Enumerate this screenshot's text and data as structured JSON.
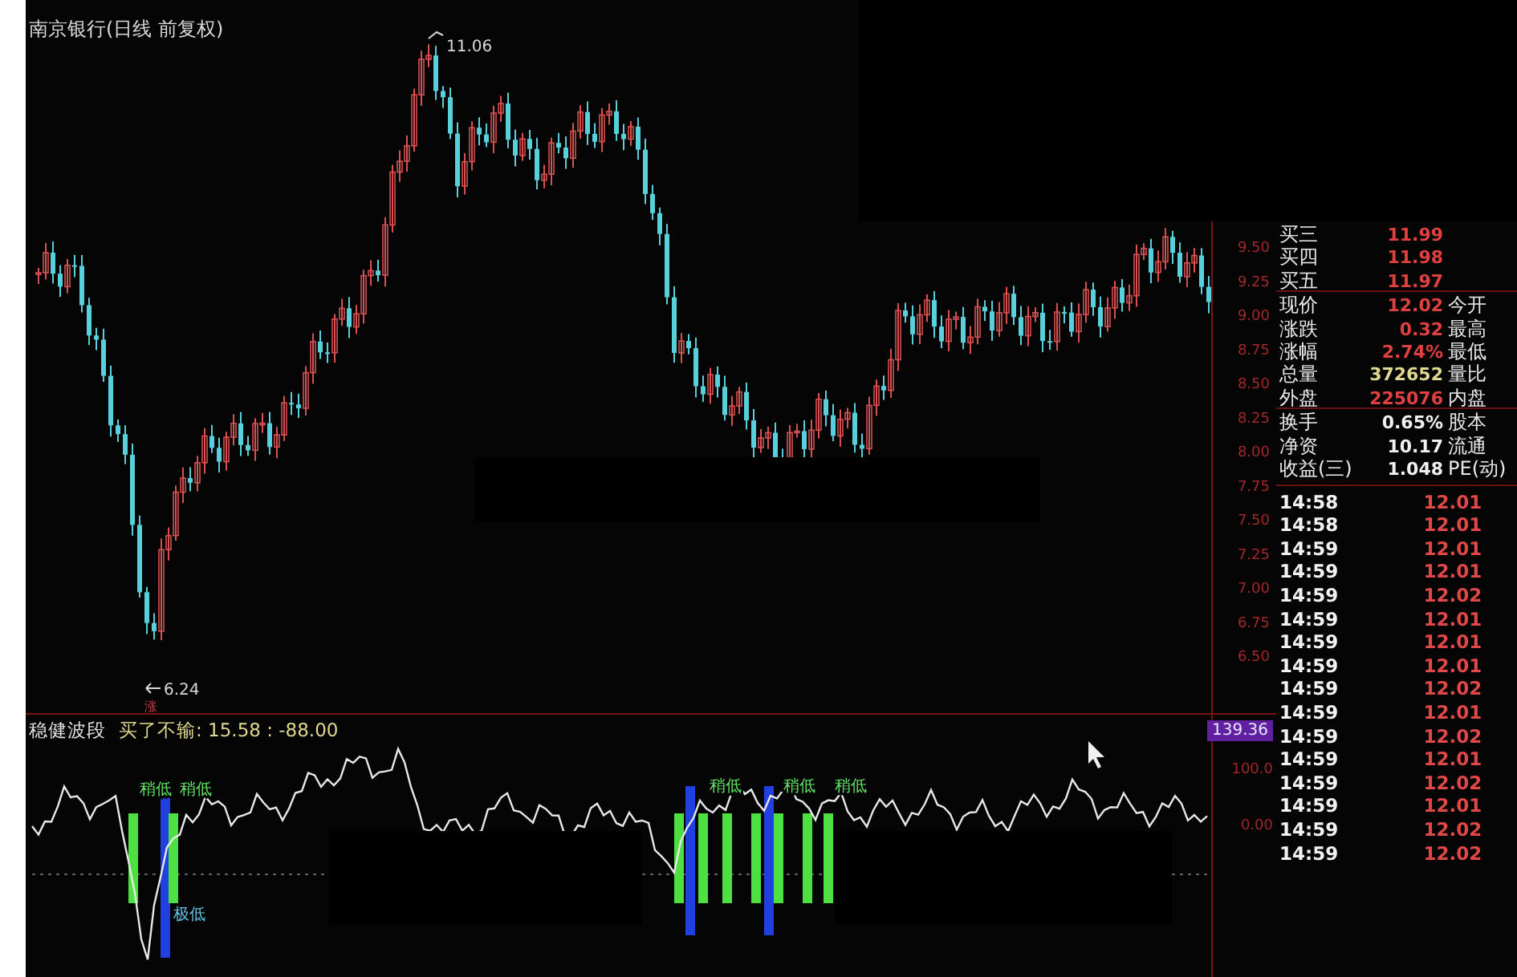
{
  "chart": {
    "title": "南京银行(日线 前复权)",
    "high_label": "11.06",
    "low_label": "6.24",
    "rise_mark": "涨",
    "price_ticks": [
      "9.50",
      "9.25",
      "9.00",
      "8.75",
      "8.50",
      "8.25",
      "8.00",
      "7.75",
      "7.50",
      "7.25",
      "7.00",
      "6.75",
      "6.50"
    ]
  },
  "indicator": {
    "name": "稳健波段",
    "readout": "买了不输: 15.58 : -88.00",
    "current_tag": "139.36",
    "ticks": [
      "100.0",
      "0.00"
    ],
    "signals": [
      {
        "label": "稍低"
      },
      {
        "label": "稍低"
      },
      {
        "label": "极低"
      },
      {
        "label": "稍低"
      },
      {
        "label": "稍低"
      },
      {
        "label": "稍低"
      }
    ]
  },
  "quote": [
    {
      "label": "买三",
      "value": "11.99",
      "color": "#e04040"
    },
    {
      "label": "买四",
      "value": "11.98",
      "color": "#e04040"
    },
    {
      "label": "买五",
      "value": "11.97",
      "color": "#e04040"
    },
    {
      "label": "现价",
      "value": "12.02",
      "color": "#e04040",
      "label2": "今开"
    },
    {
      "label": "涨跌",
      "value": "0.32",
      "color": "#e04040",
      "label2": "最高"
    },
    {
      "label": "涨幅",
      "value": "2.74%",
      "color": "#e04040",
      "label2": "最低"
    },
    {
      "label": "总量",
      "value": "372652",
      "color": "#e0d890",
      "label2": "量比"
    },
    {
      "label": "外盘",
      "value": "225076",
      "color": "#e04040",
      "label2": "内盘"
    },
    {
      "label": "换手",
      "value": "0.65%",
      "color": "#f0f0f0",
      "label2": "股本"
    },
    {
      "label": "净资",
      "value": "10.17",
      "color": "#f0f0f0",
      "label2": "流通"
    },
    {
      "label": "收益(三)",
      "value": "1.048",
      "color": "#f0f0f0",
      "label2": "PE(动)"
    }
  ],
  "ticks": [
    {
      "time": "14:58",
      "price": "12.01"
    },
    {
      "time": "14:58",
      "price": "12.01"
    },
    {
      "time": "14:59",
      "price": "12.01"
    },
    {
      "time": "14:59",
      "price": "12.01"
    },
    {
      "time": "14:59",
      "price": "12.02"
    },
    {
      "time": "14:59",
      "price": "12.01"
    },
    {
      "time": "14:59",
      "price": "12.01"
    },
    {
      "time": "14:59",
      "price": "12.01"
    },
    {
      "time": "14:59",
      "price": "12.02"
    },
    {
      "time": "14:59",
      "price": "12.01"
    },
    {
      "time": "14:59",
      "price": "12.02"
    },
    {
      "time": "14:59",
      "price": "12.01"
    },
    {
      "time": "14:59",
      "price": "12.02"
    },
    {
      "time": "14:59",
      "price": "12.01"
    },
    {
      "time": "14:59",
      "price": "12.02"
    },
    {
      "time": "14:59",
      "price": "12.02"
    }
  ]
}
